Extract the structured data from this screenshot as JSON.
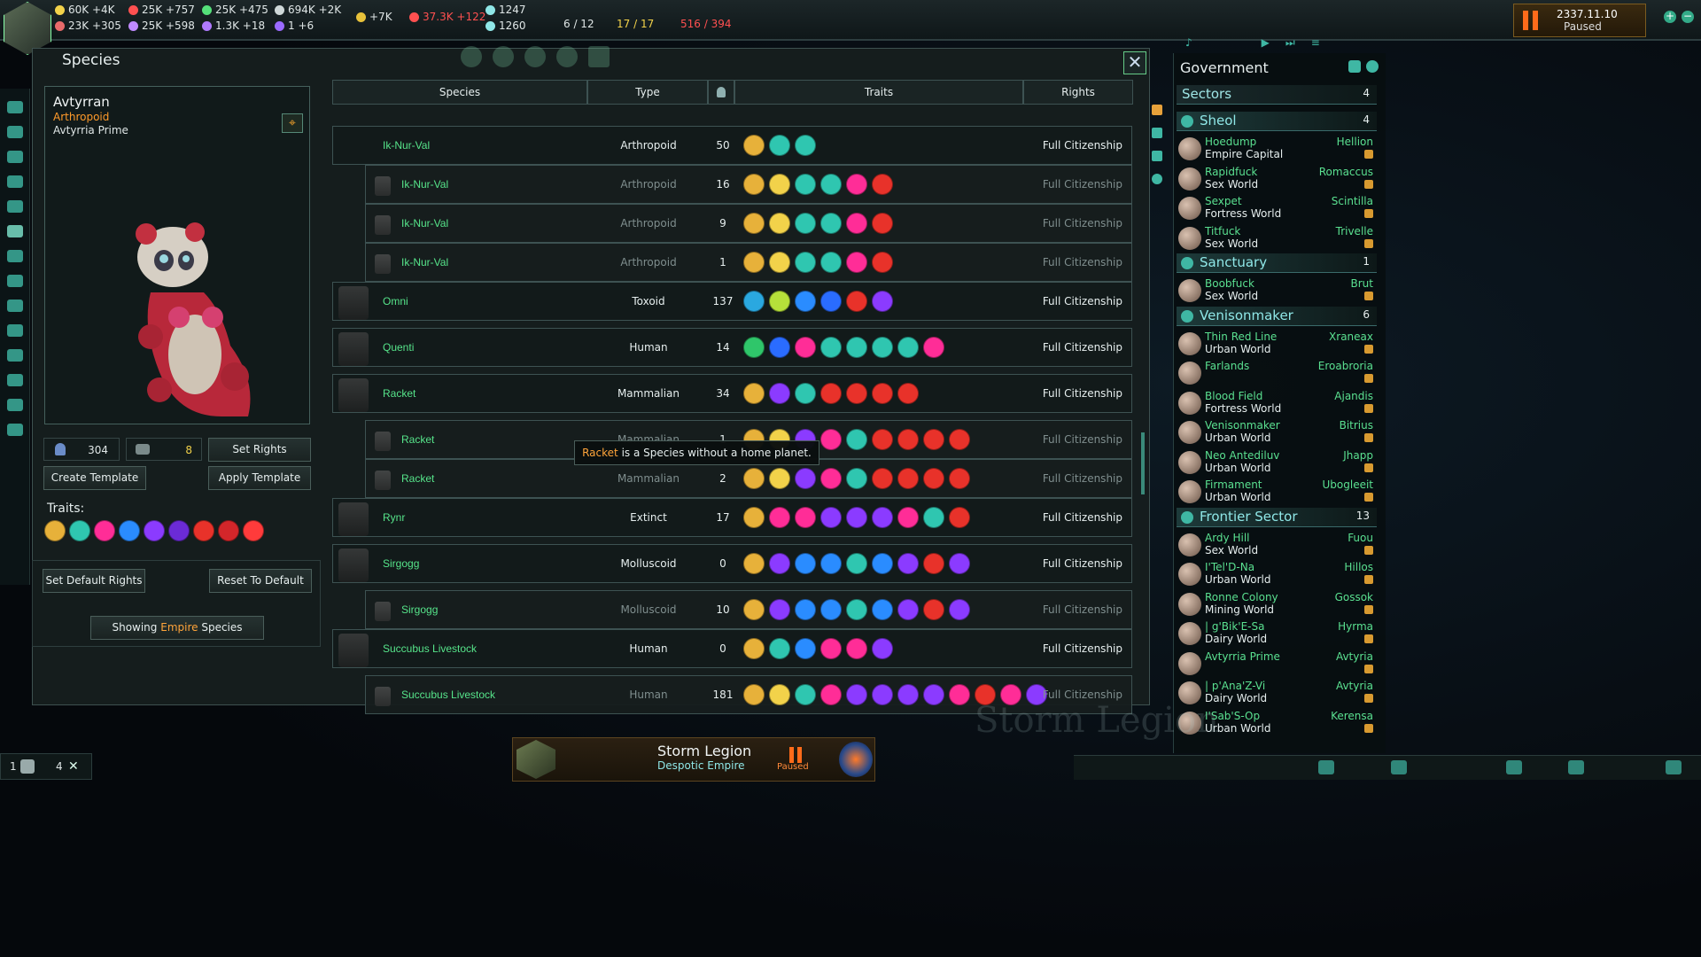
{
  "topbar": {
    "resources": [
      {
        "label": "60K +4K",
        "color": "#f2d24a"
      },
      {
        "label": "25K +757",
        "color": "#ff5050"
      },
      {
        "label": "25K +475",
        "color": "#55e07a"
      },
      {
        "label": "694K +2K",
        "color": "#e8eef0"
      },
      {
        "label": "23K +305",
        "color": "#e8eef0"
      },
      {
        "label": "25K +598",
        "color": "#c08aff"
      },
      {
        "label": "1.3K +18",
        "color": "#e8eef0"
      },
      {
        "label": "1 +6",
        "color": "#e8eef0"
      },
      {
        "label": "+7K",
        "color": "#e8eef0"
      },
      {
        "label": "37.3K +122",
        "color": "#ff5050"
      },
      {
        "label": "1247",
        "color": "#e8eef0"
      },
      {
        "label": "1260",
        "color": "#e8eef0"
      },
      {
        "label": "6 / 12",
        "color": "#e8eef0"
      },
      {
        "label": "17 / 17",
        "color": "#f2d24a"
      },
      {
        "label": "516 / 394",
        "color": "#ff5050"
      }
    ],
    "date": "2337.11.10",
    "status": "Paused"
  },
  "window": {
    "title": "Species",
    "close_icon": "close-icon"
  },
  "selected": {
    "name": "Avtyrran",
    "class": "Arthropoid",
    "homeworld": "Avtyrria Prime",
    "pop_count": "304",
    "other_count": "8",
    "traits_label": "Traits:",
    "traits": [
      "#e7b13a",
      "#2fc6b0",
      "#ff2d97",
      "#2a8cff",
      "#8b3bff",
      "#6b2bd6",
      "#e8322a",
      "#d4262a",
      "#ff3b3b"
    ]
  },
  "buttons": {
    "set_rights": "Set Rights",
    "create_template": "Create Template",
    "apply_template": "Apply Template",
    "set_default_rights": "Set Default Rights",
    "reset_to_default": "Reset To Default",
    "showing_prefix": "Showing",
    "showing_mid": "Empire",
    "showing_suffix": "Species"
  },
  "table": {
    "headers": {
      "species": "Species",
      "type": "Type",
      "traits": "Traits",
      "rights": "Rights"
    },
    "rows": [
      {
        "name": "Ik-Nur-Val",
        "type": "Arthropoid",
        "pop": "50",
        "rights": "Full Citizenship",
        "sub": false,
        "traits": [
          "#e7b13a",
          "#2fc6b0",
          "#2fc6b0"
        ]
      },
      {
        "name": "Ik-Nur-Val",
        "type": "Arthropoid",
        "pop": "16",
        "rights": "Full Citizenship",
        "sub": true,
        "traits": [
          "#e7b13a",
          "#f2d24a",
          "#2fc6b0",
          "#2fc6b0",
          "#ff2d97",
          "#e8322a"
        ]
      },
      {
        "name": "Ik-Nur-Val",
        "type": "Arthropoid",
        "pop": "9",
        "rights": "Full Citizenship",
        "sub": true,
        "traits": [
          "#e7b13a",
          "#f2d24a",
          "#2fc6b0",
          "#2fc6b0",
          "#ff2d97",
          "#e8322a"
        ]
      },
      {
        "name": "Ik-Nur-Val",
        "type": "Arthropoid",
        "pop": "1",
        "rights": "Full Citizenship",
        "sub": true,
        "traits": [
          "#e7b13a",
          "#f2d24a",
          "#2fc6b0",
          "#2fc6b0",
          "#ff2d97",
          "#e8322a"
        ]
      },
      {
        "name": "Omni",
        "type": "Toxoid",
        "pop": "137",
        "rights": "Full Citizenship",
        "sub": false,
        "traits": [
          "#2aa8e0",
          "#b6e03a",
          "#2a8cff",
          "#2a6cff",
          "#e8322a",
          "#8b3bff"
        ]
      },
      {
        "name": "Quenti",
        "type": "Human",
        "pop": "14",
        "rights": "Full Citizenship",
        "sub": false,
        "traits": [
          "#2fc66a",
          "#2a6cff",
          "#ff2d97",
          "#2fc6b0",
          "#2fc6b0",
          "#2fc6b0",
          "#2fc6b0",
          "#ff2d97"
        ]
      },
      {
        "name": "Racket",
        "type": "Mammalian",
        "pop": "34",
        "rights": "Full Citizenship",
        "sub": false,
        "traits": [
          "#e7b13a",
          "#8b3bff",
          "#2fc6b0",
          "#e8322a",
          "#e8322a",
          "#e8322a",
          "#e8322a"
        ]
      },
      {
        "name": "Racket",
        "type": "Mammalian",
        "pop": "1",
        "rights": "Full Citizenship",
        "sub": true,
        "traits": [
          "#e7b13a",
          "#f2d24a",
          "#8b3bff",
          "#ff2d97",
          "#2fc6b0",
          "#e8322a",
          "#e8322a",
          "#e8322a",
          "#e8322a"
        ]
      },
      {
        "name": "Racket",
        "type": "Mammalian",
        "pop": "2",
        "rights": "Full Citizenship",
        "sub": true,
        "traits": [
          "#e7b13a",
          "#f2d24a",
          "#8b3bff",
          "#ff2d97",
          "#2fc6b0",
          "#e8322a",
          "#e8322a",
          "#e8322a",
          "#e8322a"
        ]
      },
      {
        "name": "Rynr",
        "type": "Extinct",
        "pop": "17",
        "rights": "Full Citizenship",
        "sub": false,
        "traits": [
          "#e7b13a",
          "#ff2d97",
          "#ff2d97",
          "#8b3bff",
          "#8b3bff",
          "#8b3bff",
          "#ff2d97",
          "#2fc6b0",
          "#e8322a"
        ]
      },
      {
        "name": "Sirgogg",
        "type": "Molluscoid",
        "pop": "0",
        "rights": "Full Citizenship",
        "sub": false,
        "traits": [
          "#e7b13a",
          "#8b3bff",
          "#2a8cff",
          "#2a8cff",
          "#2fc6b0",
          "#2a8cff",
          "#8b3bff",
          "#e8322a",
          "#8b3bff"
        ]
      },
      {
        "name": "Sirgogg",
        "type": "Molluscoid",
        "pop": "10",
        "rights": "Full Citizenship",
        "sub": true,
        "traits": [
          "#e7b13a",
          "#8b3bff",
          "#2a8cff",
          "#2a8cff",
          "#2fc6b0",
          "#2a8cff",
          "#8b3bff",
          "#e8322a",
          "#8b3bff"
        ]
      },
      {
        "name": "Succubus Livestock",
        "type": "Human",
        "pop": "0",
        "rights": "Full Citizenship",
        "sub": false,
        "traits": [
          "#e7b13a",
          "#2fc6b0",
          "#2a8cff",
          "#ff2d97",
          "#ff2d97",
          "#8b3bff"
        ]
      },
      {
        "name": "Succubus Livestock",
        "type": "Human",
        "pop": "181",
        "rights": "Full Citizenship",
        "sub": true,
        "traits": [
          "#e7b13a",
          "#f2d24a",
          "#2fc6b0",
          "#ff2d97",
          "#8b3bff",
          "#8b3bff",
          "#8b3bff",
          "#8b3bff",
          "#ff2d97",
          "#e8322a",
          "#ff2d97",
          "#8b3bff"
        ]
      }
    ]
  },
  "tooltip": {
    "name": "Racket",
    "text": " is a Species without a home planet."
  },
  "government": {
    "title": "Government",
    "sectors_label": "Sectors",
    "sectors_count": "4",
    "sectors": [
      {
        "name": "Sheol",
        "count": "4",
        "planets": [
          {
            "name": "Hoedump",
            "type": "Empire Capital",
            "gov": "Hellion"
          },
          {
            "name": "Rapidfuck",
            "type": "Sex World",
            "gov": "Romaccus"
          },
          {
            "name": "Sexpet",
            "type": "Fortress World",
            "gov": "Scintilla"
          },
          {
            "name": "Titfuck",
            "type": "Sex World",
            "gov": "Trivelle"
          }
        ]
      },
      {
        "name": "Sanctuary",
        "count": "1",
        "planets": [
          {
            "name": "Boobfuck",
            "type": "Sex World",
            "gov": "Brut"
          }
        ]
      },
      {
        "name": "Venisonmaker",
        "count": "6",
        "planets": [
          {
            "name": "Thin Red Line",
            "type": "Urban World",
            "gov": "Xraneax"
          },
          {
            "name": "Farlands",
            "type": "",
            "gov": "Eroabroria"
          },
          {
            "name": "Blood Field",
            "type": "Fortress World",
            "gov": "Ajandis"
          },
          {
            "name": "Venisonmaker",
            "type": "Urban World",
            "gov": "Bitrius"
          },
          {
            "name": "Neo Antediluv",
            "type": "Urban World",
            "gov": "Jhapp"
          },
          {
            "name": "Firmament",
            "type": "Urban World",
            "gov": "Ubogleeit"
          }
        ]
      },
      {
        "name": "Frontier Sector",
        "count": "13",
        "planets": [
          {
            "name": "Ardy Hill",
            "type": "Sex World",
            "gov": "Fuou"
          },
          {
            "name": "I'Tel'D-Na",
            "type": "Urban World",
            "gov": "Hillos"
          },
          {
            "name": "Ronne Colony",
            "type": "Mining World",
            "gov": "Gossok"
          },
          {
            "name": "| g'Bik'E-Sa",
            "type": "Dairy World",
            "gov": "Hyrma"
          },
          {
            "name": "Avtyrria Prime",
            "type": "",
            "gov": "Avtyria"
          },
          {
            "name": "| p'Ana'Z-Vi",
            "type": "Dairy World",
            "gov": "Avtyria"
          },
          {
            "name": "I'Sab'S-Op",
            "type": "Urban World",
            "gov": "Kerensa"
          }
        ]
      }
    ]
  },
  "bottom": {
    "empire_name": "Storm Legion",
    "empire_gov": "Despotic Empire",
    "status": "Paused",
    "left_a": "1",
    "left_b": "4",
    "bg_text": "Storm Legion"
  }
}
